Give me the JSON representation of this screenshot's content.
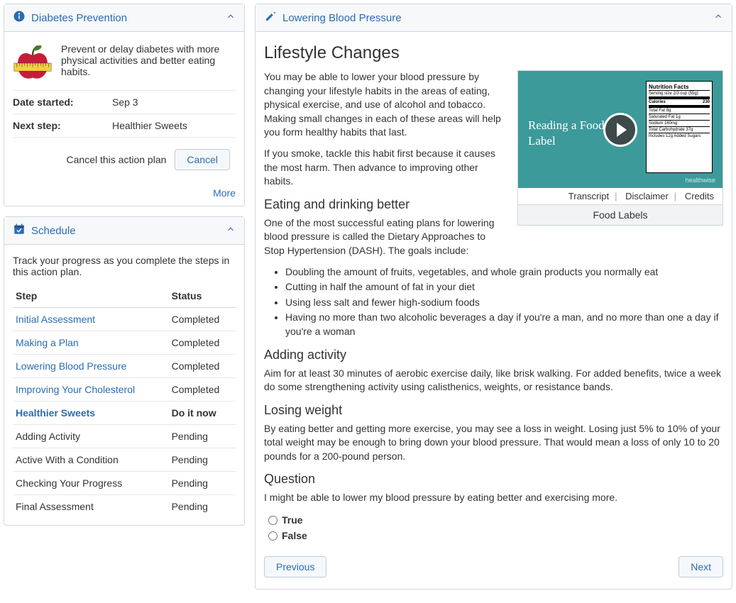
{
  "prevention": {
    "title": "Diabetes Prevention",
    "intro": "Prevent or delay diabetes with more physical activities and better eating habits.",
    "date_started_label": "Date started:",
    "date_started_value": "Sep 3",
    "next_step_label": "Next step:",
    "next_step_value": "Healthier Sweets",
    "cancel_text": "Cancel this action plan",
    "cancel_button": "Cancel",
    "more": "More"
  },
  "schedule": {
    "title": "Schedule",
    "desc": "Track your progress as you complete the steps in this action plan.",
    "col_step": "Step",
    "col_status": "Status",
    "steps": [
      {
        "label": "Initial Assessment",
        "status": "Completed",
        "kind": "link"
      },
      {
        "label": "Making a Plan",
        "status": "Completed",
        "kind": "link"
      },
      {
        "label": "Lowering Blood Pressure",
        "status": "Completed",
        "kind": "link"
      },
      {
        "label": "Improving Your Cholesterol",
        "status": "Completed",
        "kind": "link"
      },
      {
        "label": "Healthier Sweets",
        "status": "Do it now",
        "kind": "current"
      },
      {
        "label": "Adding Activity",
        "status": "Pending",
        "kind": "plain"
      },
      {
        "label": "Active With a Condition",
        "status": "Pending",
        "kind": "plain"
      },
      {
        "label": "Checking Your Progress",
        "status": "Pending",
        "kind": "plain"
      },
      {
        "label": "Final Assessment",
        "status": "Pending",
        "kind": "plain"
      }
    ]
  },
  "article": {
    "header": "Lowering Blood Pressure",
    "title": "Lifestyle Changes",
    "p1": "You may be able to lower your blood pressure by changing your lifestyle habits in the areas of eating, physical exercise, and use of alcohol and tobacco. Making small changes in each of these areas will help you form healthy habits that last.",
    "p2": "If you smoke, tackle this habit first because it causes the most harm. Then advance to improving other habits.",
    "h_eat": "Eating and drinking better",
    "p_eat": "One of the most successful eating plans for lowering blood pressure is called the Dietary Approaches to Stop Hypertension (DASH). The goals include:",
    "bullets": [
      "Doubling the amount of fruits, vegetables, and whole grain products you normally eat",
      "Cutting in half the amount of fat in your diet",
      "Using less salt and fewer high-sodium foods",
      "Having no more than two alcoholic beverages a day if you're a man, and no more than one a day if you're a woman"
    ],
    "h_act": "Adding activity",
    "p_act": "Aim for at least 30 minutes of aerobic exercise daily, like brisk walking. For added benefits, twice a week do some strengthening activity using calisthenics, weights, or resistance bands.",
    "h_weight": "Losing weight",
    "p_weight": "By eating better and getting more exercise, you may see a loss in weight. Losing just 5% to 10% of your total weight may be enough to bring down your blood pressure. That would mean a loss of only 10 to 20 pounds for a 200-pound person.",
    "h_q": "Question",
    "q_text": "I might be able to lower my blood pressure by eating better and exercising more.",
    "opt_true": "True",
    "opt_false": "False",
    "prev": "Previous",
    "next": "Next"
  },
  "video": {
    "thumb_title": "Reading a Food Label",
    "nf_title": "Nutrition Facts",
    "nf_serving": "Serving size   2/3 cup (55g)",
    "nf_cal_label": "Calories",
    "nf_cal_value": "230",
    "transcript": "Transcript",
    "disclaimer": "Disclaimer",
    "credits": "Credits",
    "caption": "Food Labels",
    "logo": "healthwise"
  }
}
